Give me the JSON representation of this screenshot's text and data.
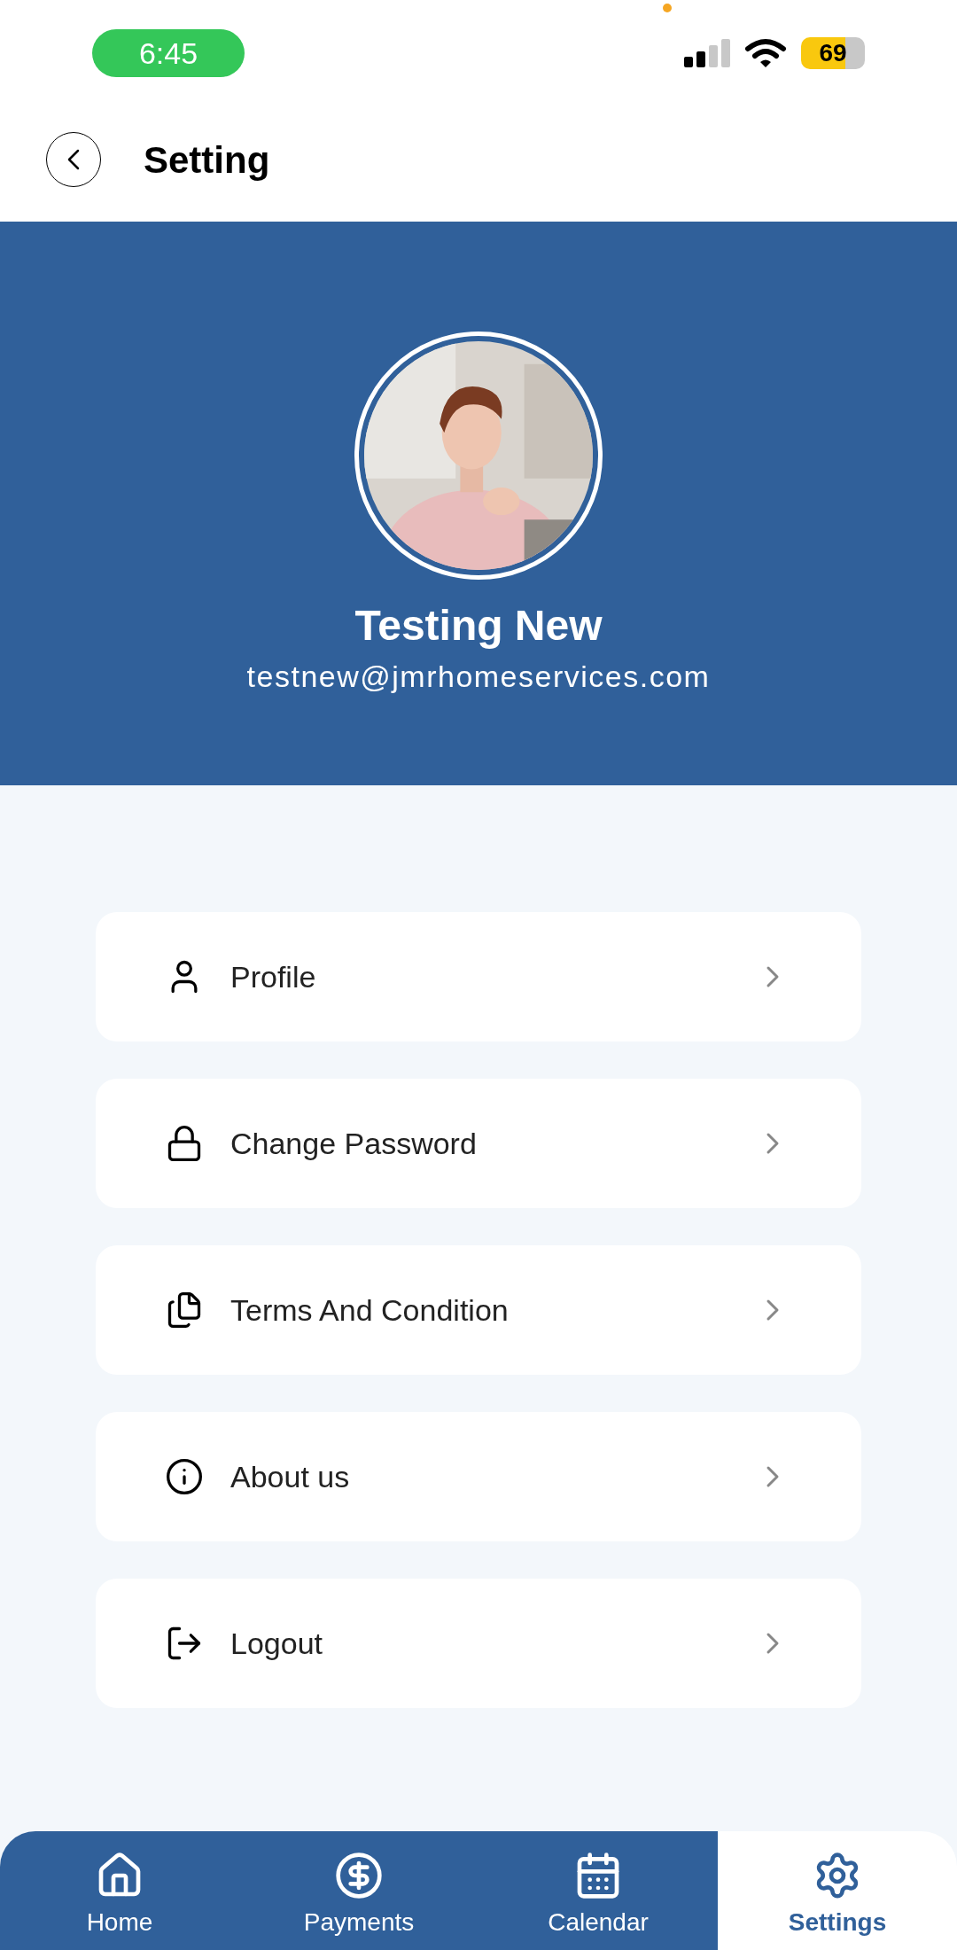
{
  "status_bar": {
    "time": "6:45",
    "battery": "69"
  },
  "header": {
    "title": "Setting"
  },
  "profile": {
    "name": "Testing New",
    "email": "testnew@jmrhomeservices.com"
  },
  "menu": [
    {
      "kind": "profile",
      "label": "Profile"
    },
    {
      "kind": "password",
      "label": "Change Password"
    },
    {
      "kind": "terms",
      "label": "Terms And Condition"
    },
    {
      "kind": "about",
      "label": "About us"
    },
    {
      "kind": "logout",
      "label": "Logout"
    }
  ],
  "bottom_nav": [
    {
      "kind": "home",
      "label": "Home",
      "selected": false
    },
    {
      "kind": "payments",
      "label": "Payments",
      "selected": false
    },
    {
      "kind": "calendar",
      "label": "Calendar",
      "selected": false
    },
    {
      "kind": "settings",
      "label": "Settings",
      "selected": true
    }
  ]
}
